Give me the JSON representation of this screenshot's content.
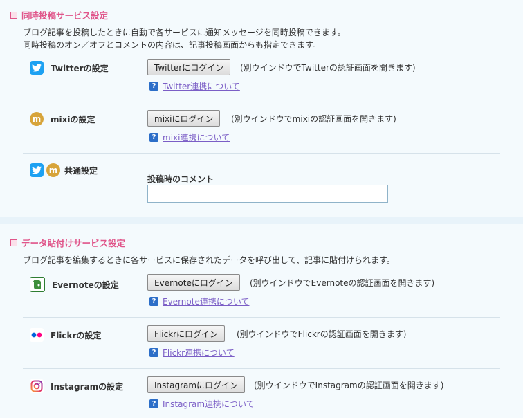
{
  "section1": {
    "title": "同時投稿サービス設定",
    "desc_line1": "ブログ記事を投稿したときに自動で各サービスに通知メッセージを同時投稿できます。",
    "desc_line2": "同時投稿のオン／オフとコメントの内容は、記事投稿画面からも指定できます。",
    "twitter": {
      "label": "Twitterの設定",
      "button": "Twitterにログイン",
      "note": "(別ウインドウでTwitterの認証画面を開きます)",
      "help": "Twitter連携について"
    },
    "mixi": {
      "label": "mixiの設定",
      "button": "mixiにログイン",
      "note": "(別ウインドウでmixiの認証画面を開きます)",
      "help": "mixi連携について"
    },
    "common": {
      "label": "共通設定",
      "comment_label": "投稿時のコメント",
      "comment_value": ""
    }
  },
  "section2": {
    "title": "データ貼付けサービス設定",
    "desc": "ブログ記事を編集するときに各サービスに保存されたデータを呼び出して、記事に貼付けられます。",
    "evernote": {
      "label": "Evernoteの設定",
      "button": "Evernoteにログイン",
      "note": "(別ウインドウでEvernoteの認証画面を開きます)",
      "help": "Evernote連携について"
    },
    "flickr": {
      "label": "Flickrの設定",
      "button": "Flickrにログイン",
      "note": "(別ウインドウでFlickrの認証画面を開きます)",
      "help": "Flickr連携について"
    },
    "instagram": {
      "label": "Instagramの設定",
      "button": "Instagramにログイン",
      "note": "(別ウインドウでInstagramの認証画面を開きます)",
      "help": "Instagram連携について"
    }
  },
  "icons": {
    "help": "?",
    "mixi": "m"
  },
  "colors": {
    "section_title": "#e0558a",
    "link": "#7b5ec6",
    "twitter": "#1da1f2",
    "mixi": "#d7a43a",
    "help_icon": "#2c6ec8"
  }
}
